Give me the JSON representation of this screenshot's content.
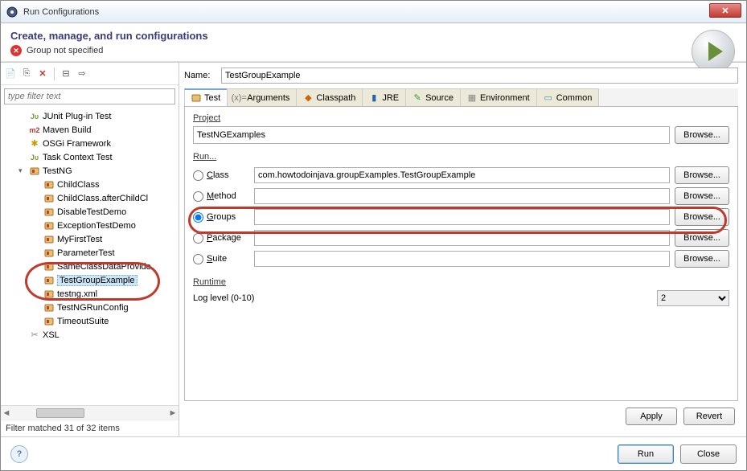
{
  "window": {
    "title": "Run Configurations"
  },
  "header": {
    "title": "Create, manage, and run configurations",
    "error": "Group not specified"
  },
  "left": {
    "filter_placeholder": "type filter text",
    "tree": [
      {
        "label": "JUnit Plug-in Test",
        "icon": "ju",
        "lvl": 1
      },
      {
        "label": "Maven Build",
        "icon": "m2",
        "lvl": 1
      },
      {
        "label": "OSGi Framework",
        "icon": "osgi",
        "lvl": 1
      },
      {
        "label": "Task Context Test",
        "icon": "ju",
        "lvl": 1
      },
      {
        "label": "TestNG",
        "icon": "ng",
        "lvl": 1,
        "expanded": true
      },
      {
        "label": "ChildClass",
        "icon": "ng",
        "lvl": 2
      },
      {
        "label": "ChildClass.afterChildCl",
        "icon": "ng",
        "lvl": 2
      },
      {
        "label": "DisableTestDemo",
        "icon": "ng",
        "lvl": 2
      },
      {
        "label": "ExceptionTestDemo",
        "icon": "ng",
        "lvl": 2
      },
      {
        "label": "MyFirstTest",
        "icon": "ng",
        "lvl": 2
      },
      {
        "label": "ParameterTest",
        "icon": "ng",
        "lvl": 2
      },
      {
        "label": "SameClassDataProvide",
        "icon": "ng",
        "lvl": 2
      },
      {
        "label": "TestGroupExample",
        "icon": "ng",
        "lvl": 2,
        "selected": true
      },
      {
        "label": "testng.xml",
        "icon": "ng",
        "lvl": 2
      },
      {
        "label": "TestNGRunConfig",
        "icon": "ng",
        "lvl": 2
      },
      {
        "label": "TimeoutSuite",
        "icon": "ng",
        "lvl": 2
      },
      {
        "label": "XSL",
        "icon": "xsl",
        "lvl": 1
      }
    ],
    "filter_count": "Filter matched 31 of 32 items"
  },
  "right": {
    "name_label": "Name:",
    "name_value": "TestGroupExample",
    "tabs": [
      {
        "label": "Test",
        "active": true
      },
      {
        "label": "Arguments"
      },
      {
        "label": "Classpath"
      },
      {
        "label": "JRE"
      },
      {
        "label": "Source"
      },
      {
        "label": "Environment"
      },
      {
        "label": "Common"
      }
    ],
    "project": {
      "label": "Project",
      "value": "TestNGExamples",
      "browse": "Browse..."
    },
    "run": {
      "label": "Run...",
      "rows": [
        {
          "key": "class",
          "label": "Class",
          "value": "com.howtodoinjava.groupExamples.TestGroupExample",
          "checked": false,
          "browse": "Browse..."
        },
        {
          "key": "method",
          "label": "Method",
          "value": "",
          "checked": false,
          "browse": "Browse..."
        },
        {
          "key": "groups",
          "label": "Groups",
          "value": "",
          "checked": true,
          "browse": "Browse..."
        },
        {
          "key": "package",
          "label": "Package",
          "value": "",
          "checked": false,
          "browse": "Browse..."
        },
        {
          "key": "suite",
          "label": "Suite",
          "value": "",
          "checked": false,
          "browse": "Browse..."
        }
      ]
    },
    "runtime": {
      "label": "Runtime",
      "log_label": "Log level (0-10)",
      "log_value": "2"
    },
    "apply": "Apply",
    "revert": "Revert"
  },
  "footer": {
    "run": "Run",
    "close": "Close"
  }
}
